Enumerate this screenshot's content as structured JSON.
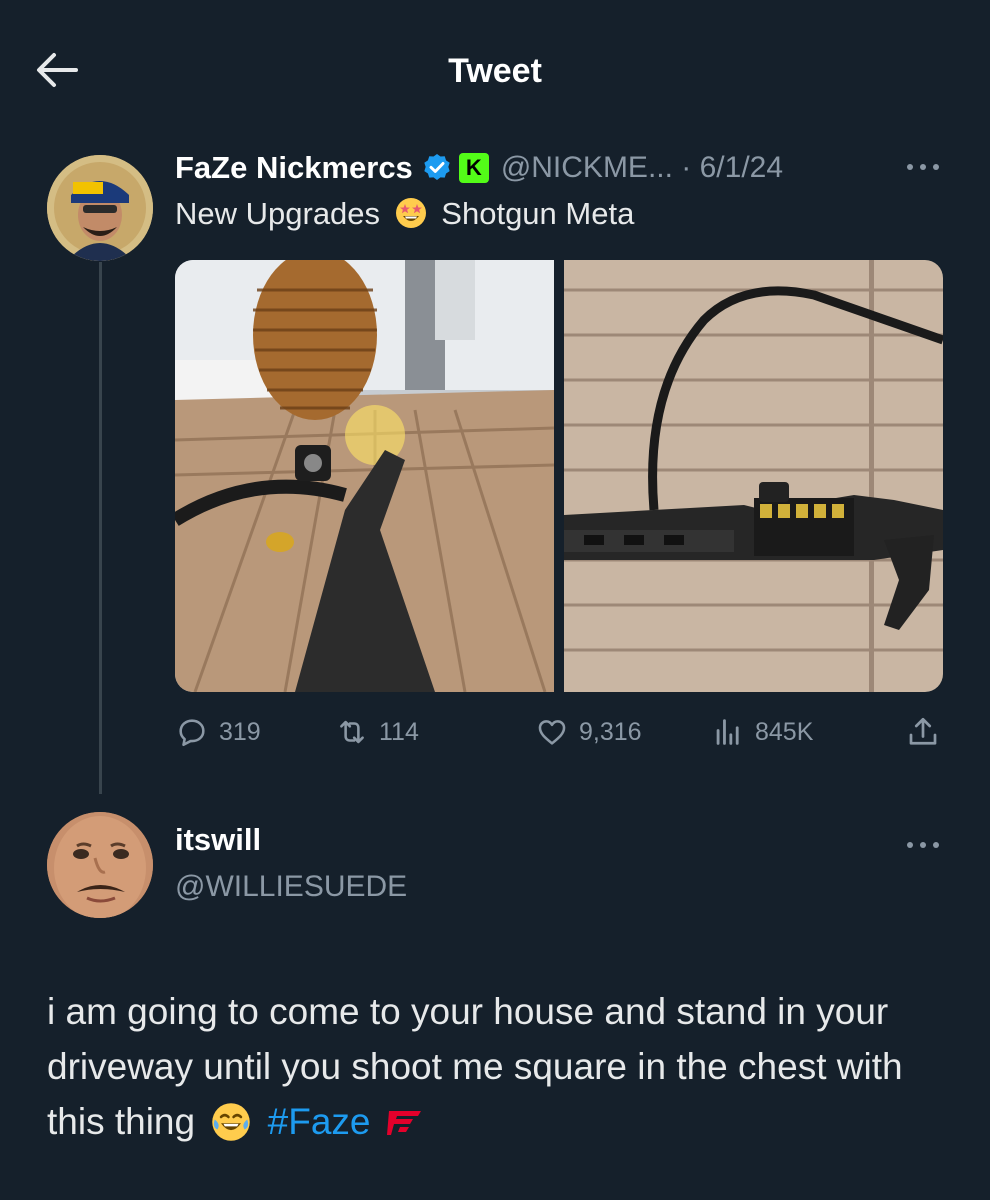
{
  "header": {
    "title": "Tweet"
  },
  "tweet": {
    "author_name": "FaZe Nickmercs",
    "handle": "@NICKME...",
    "date": "· 6/1/24",
    "text_before_emoji": "New Upgrades",
    "text_after_emoji": "Shotgun Meta",
    "kick_badge": "K",
    "stats": {
      "replies": "319",
      "retweets": "114",
      "likes": "9,316",
      "views": "845K"
    }
  },
  "reply": {
    "author_name": "itswill",
    "handle": "@WILLIESUEDE",
    "text": "i am going to come to your house and stand in your driveway until you shoot me square in the chest with this thing",
    "hashtag": "#Faze"
  },
  "colors": {
    "background": "#15202b",
    "accent": "#1d9bf0",
    "secondary_text": "#8b98a5",
    "kick_green": "#53fc18",
    "faze_red": "#e4002b"
  },
  "icons": [
    "back-arrow-icon",
    "verified-badge-icon",
    "kick-badge-icon",
    "more-icon",
    "reply-icon",
    "retweet-icon",
    "like-icon",
    "views-icon",
    "share-icon",
    "laughing-emoji-icon",
    "star-struck-emoji-icon",
    "faze-logo-icon"
  ]
}
